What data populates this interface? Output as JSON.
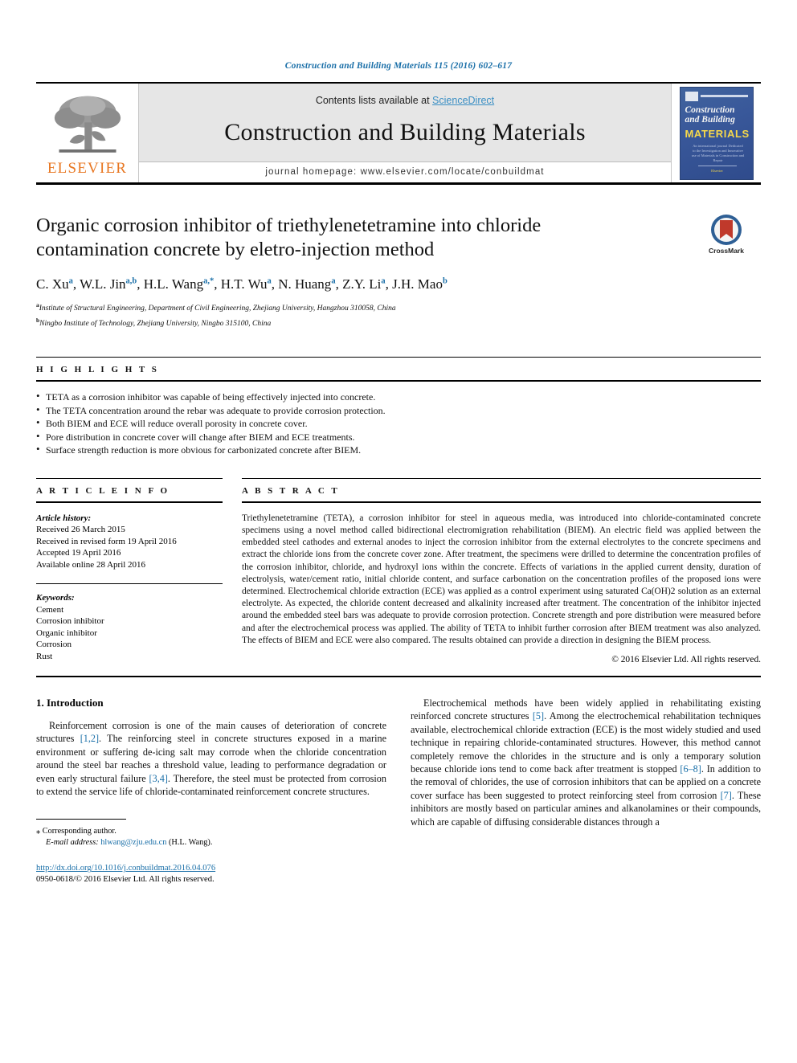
{
  "running_head": "Construction and Building Materials 115 (2016) 602–617",
  "masthead": {
    "publisher_name": "ELSEVIER",
    "contents_prefix": "Contents lists available at ",
    "contents_link": "ScienceDirect",
    "journal_title": "Construction and Building Materials",
    "homepage": "journal homepage: www.elsevier.com/locate/conbuildmat",
    "cover": {
      "line1": "Construction",
      "line2": "and Building",
      "line3": "MATERIALS",
      "subtitle": "An international journal Dedicated to the Investigation and Innovative use of Materials in Construction and Repair",
      "footer": "Elsevier"
    }
  },
  "article": {
    "title": "Organic corrosion inhibitor of triethylenetetramine into chloride contamination concrete by eletro-injection method",
    "authors": [
      {
        "name": "C. Xu",
        "sup": "a"
      },
      {
        "name": "W.L. Jin",
        "sup": "a,b"
      },
      {
        "name": "H.L. Wang",
        "sup": "a,*"
      },
      {
        "name": "H.T. Wu",
        "sup": "a"
      },
      {
        "name": "N. Huang",
        "sup": "a"
      },
      {
        "name": "Z.Y. Li",
        "sup": "a"
      },
      {
        "name": "J.H. Mao",
        "sup": "b"
      }
    ],
    "affiliations": [
      {
        "mark": "a",
        "text": "Institute of Structural Engineering, Department of Civil Engineering, Zhejiang University, Hangzhou 310058, China"
      },
      {
        "mark": "b",
        "text": "Ningbo Institute of Technology, Zhejiang University, Ningbo 315100, China"
      }
    ],
    "crossmark_label": "CrossMark"
  },
  "highlights": {
    "heading": "H I G H L I G H T S",
    "items": [
      "TETA as a corrosion inhibitor was capable of being effectively injected into concrete.",
      "The TETA concentration around the rebar was adequate to provide corrosion protection.",
      "Both BIEM and ECE will reduce overall porosity in concrete cover.",
      "Pore distribution in concrete cover will change after BIEM and ECE treatments.",
      "Surface strength reduction is more obvious for carbonizated concrete after BIEM."
    ]
  },
  "article_info": {
    "heading": "A R T I C L E   I N F O",
    "history_label": "Article history:",
    "history": [
      "Received 26 March 2015",
      "Received in revised form 19 April 2016",
      "Accepted 19 April 2016",
      "Available online 28 April 2016"
    ],
    "keywords_label": "Keywords:",
    "keywords": [
      "Cement",
      "Corrosion inhibitor",
      "Organic inhibitor",
      "Corrosion",
      "Rust"
    ]
  },
  "abstract": {
    "heading": "A B S T R A C T",
    "text": "Triethylenetetramine (TETA), a corrosion inhibitor for steel in aqueous media, was introduced into chloride-contaminated concrete specimens using a novel method called bidirectional electromigration rehabilitation (BIEM). An electric field was applied between the embedded steel cathodes and external anodes to inject the corrosion inhibitor from the external electrolytes to the concrete specimens and extract the chloride ions from the concrete cover zone. After treatment, the specimens were drilled to determine the concentration profiles of the corrosion inhibitor, chloride, and hydroxyl ions within the concrete. Effects of variations in the applied current density, duration of electrolysis, water/cement ratio, initial chloride content, and surface carbonation on the concentration profiles of the proposed ions were determined. Electrochemical chloride extraction (ECE) was applied as a control experiment using saturated Ca(OH)2 solution as an external electrolyte. As expected, the chloride content decreased and alkalinity increased after treatment. The concentration of the inhibitor injected around the embedded steel bars was adequate to provide corrosion protection. Concrete strength and pore distribution were measured before and after the electrochemical process was applied. The ability of TETA to inhibit further corrosion after BIEM treatment was also analyzed. The effects of BIEM and ECE were also compared. The results obtained can provide a direction in designing the BIEM process.",
    "copyright": "© 2016 Elsevier Ltd. All rights reserved."
  },
  "introduction": {
    "heading": "1. Introduction",
    "left_paragraph_prefix": "Reinforcement corrosion is one of the main causes of deterioration of concrete structures ",
    "left_ref1": "[1,2]",
    "left_paragraph_mid": ". The reinforcing steel in concrete structures exposed in a marine environment or suffering de-icing salt may corrode when the chloride concentration around the steel bar reaches a threshold value, leading to performance degradation or even early structural failure ",
    "left_ref2": "[3,4]",
    "left_paragraph_end": ". Therefore, the steel must be protected from corrosion to extend the service life of chloride-contaminated reinforcement concrete structures.",
    "right_paragraph_prefix": "Electrochemical methods have been widely applied in rehabilitating existing reinforced concrete structures ",
    "right_ref1": "[5]",
    "right_paragraph_mid1": ". Among the electrochemical rehabilitation techniques available, electrochemical chloride extraction (ECE) is the most widely studied and used technique in repairing chloride-contaminated structures. However, this method cannot completely remove the chlorides in the structure and is only a temporary solution because chloride ions tend to come back after treatment is stopped ",
    "right_ref2": "[6–8]",
    "right_paragraph_mid2": ". In addition to the removal of chlorides, the use of corrosion inhibitors that can be applied on a concrete cover surface has been suggested to protect reinforcing steel from corrosion ",
    "right_ref3": "[7]",
    "right_paragraph_end": ". These inhibitors are mostly based on particular amines and alkanolamines or their compounds, which are capable of diffusing considerable distances through a"
  },
  "footnotes": {
    "corresponding_mark": "⁎",
    "corresponding_text": "Corresponding author.",
    "email_label": "E-mail address:",
    "email": "hlwang@zju.edu.cn",
    "email_owner": "(H.L. Wang).",
    "doi": "http://dx.doi.org/10.1016/j.conbuildmat.2016.04.076",
    "issn_copyright": "0950-0618/© 2016 Elsevier Ltd. All rights reserved."
  },
  "colors": {
    "link_blue": "#1a6fa8",
    "elsevier_orange": "#E87722",
    "masthead_grey": "#e6e6e6"
  }
}
